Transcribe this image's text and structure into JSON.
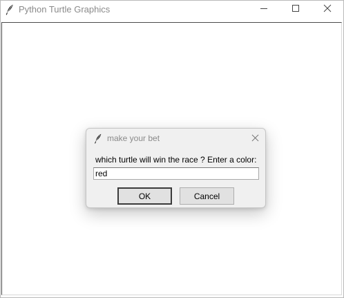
{
  "window": {
    "title": "Python Turtle Graphics",
    "icon": "feather-icon",
    "controls": [
      "minimize-icon",
      "maximize-icon",
      "close-icon"
    ]
  },
  "dialog": {
    "title": "make your bet",
    "icon": "feather-icon",
    "prompt": "which turtle will win the race ? Enter a color:",
    "input_value": "red",
    "ok_label": "OK",
    "cancel_label": "Cancel"
  },
  "colors": {
    "title_text": "#8a8a8a",
    "dialog_bg": "#f0f0f0",
    "button_bg": "#e1e1e1"
  }
}
